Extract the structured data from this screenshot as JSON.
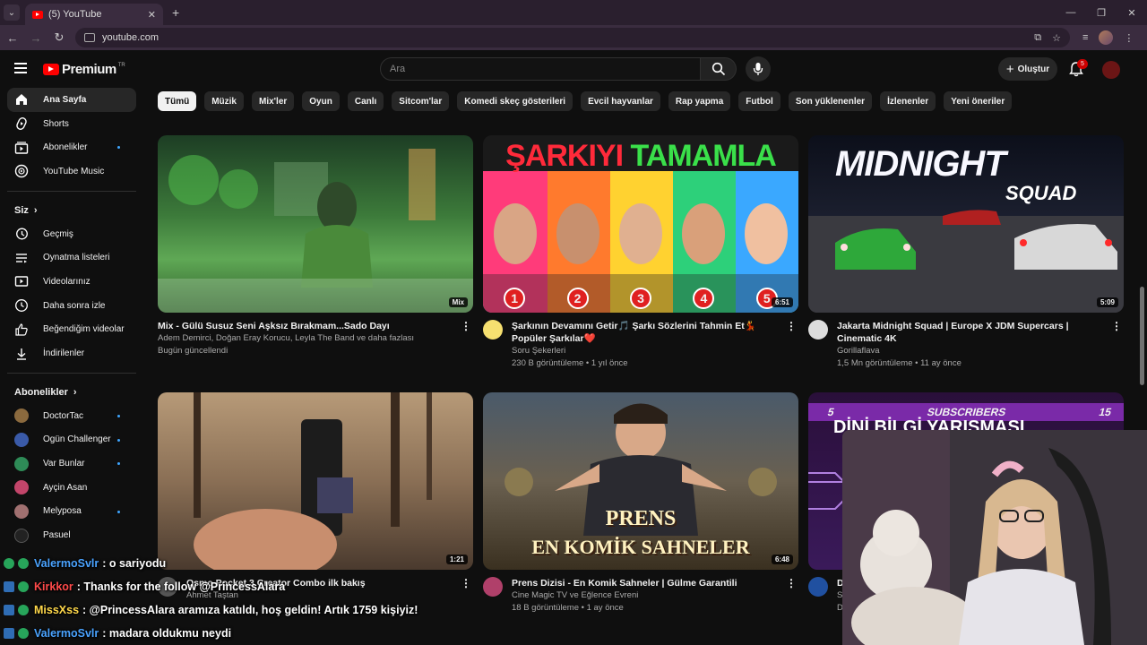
{
  "browser": {
    "tab_title": "(5) YouTube",
    "url": "youtube.com"
  },
  "header": {
    "brand": "Premium",
    "country": "TR",
    "search_placeholder": "Ara",
    "create_label": "Oluştur",
    "notif_count": "5"
  },
  "sidebar": {
    "main": [
      {
        "label": "Ana Sayfa",
        "icon": "home-icon"
      },
      {
        "label": "Shorts",
        "icon": "shorts-icon"
      },
      {
        "label": "Abonelikler",
        "icon": "subscriptions-icon"
      },
      {
        "label": "YouTube Music",
        "icon": "music-icon"
      }
    ],
    "you_header": "Siz",
    "you": [
      {
        "label": "Geçmiş",
        "icon": "history-icon"
      },
      {
        "label": "Oynatma listeleri",
        "icon": "playlist-icon"
      },
      {
        "label": "Videolarınız",
        "icon": "your-videos-icon"
      },
      {
        "label": "Daha sonra izle",
        "icon": "watch-later-icon"
      },
      {
        "label": "Beğendiğim videolar",
        "icon": "like-icon"
      },
      {
        "label": "İndirilenler",
        "icon": "download-icon"
      }
    ],
    "subs_header": "Abonelikler",
    "subs": [
      {
        "label": "DoctorTac",
        "color": "#8b6a3e"
      },
      {
        "label": "Ogün Challenger",
        "color": "#3a5aa8"
      },
      {
        "label": "Var Bunlar",
        "color": "#2e8b57"
      },
      {
        "label": "Ayçin Asan",
        "color": "#c2456a"
      },
      {
        "label": "Melyposa",
        "color": "#a07070"
      },
      {
        "label": "Pasuel",
        "color": "#222222"
      }
    ]
  },
  "chips": [
    "Tümü",
    "Müzik",
    "Mix'ler",
    "Oyun",
    "Canlı",
    "Sitcom'lar",
    "Komedi skeç gösterileri",
    "Evcil hayvanlar",
    "Rap yapma",
    "Futbol",
    "Son yüklenenler",
    "İzlenenler",
    "Yeni öneriler"
  ],
  "videos": [
    {
      "title": "Mix - Gülü Susuz Seni Aşksız Bırakmam...Sado Dayı",
      "line1": "Adem Demirci, Doğan Eray Korucu, Leyla The Band ve daha fazlası",
      "line2": "Bugün güncellendi",
      "badge": "Mix"
    },
    {
      "title": "Şarkının Devamını Getir🎵 Şarkı Sözlerini Tahmin Et💃Popüler Şarkılar❤️",
      "line1": "Soru Şekerleri",
      "line2": "230 B görüntüleme • 1 yıl önce",
      "badge": "6:51",
      "thumb_text1": "ŞARKIYI",
      "thumb_text2": "TAMAMLA",
      "numbers": [
        "1",
        "2",
        "3",
        "4",
        "5"
      ]
    },
    {
      "title": "Jakarta Midnight Squad | Europe X JDM Supercars | Cinematic 4K",
      "line1": "Gorillaflava",
      "line2": "1,5 Mn görüntüleme • 11 ay önce",
      "badge": "5:09",
      "thumb_text1": "MIDNIGHT",
      "thumb_text2": "SQUAD"
    },
    {
      "title": "Osmo Pocket 3 Creator Combo ilk bakış",
      "line1": "Ahmet Taştan",
      "line2": "",
      "badge": "1:21"
    },
    {
      "title": "Prens Dizisi - En Komik Sahneler | Gülme Garantili",
      "line1": "Cine Magic TV ve Eğlence Evreni",
      "line2": "18 B görüntüleme • 1 ay önce",
      "badge": "6:48",
      "thumb_text1": "PRENS",
      "thumb_text2": "EN KOMİK SAHNELER"
    },
    {
      "title": "D",
      "line1": "S",
      "line2": "Di",
      "thumb_text1": "DİNİ BİLGİ YARIŞMASI",
      "banner_left": "5",
      "banner_mid": "SUBSCRIBERS",
      "banner_right": "15"
    }
  ],
  "chat": [
    {
      "user": "ValermoSvlr",
      "text": ": o sariyodu",
      "user_color": "#4aa3ff"
    },
    {
      "user": "Kirkkor",
      "text": ": Thanks for the follow @PrincessAlara",
      "user_color": "#ff4a4a"
    },
    {
      "user": "MissXss",
      "text": ": @PrincessAlara aramıza katıldı, hoş geldin! Artık 1759 kişiyiz!",
      "user_color": "#ffd84a"
    },
    {
      "user": "ValermoSvlr",
      "text": ": madara oldukmu neydi",
      "user_color": "#4aa3ff"
    }
  ]
}
